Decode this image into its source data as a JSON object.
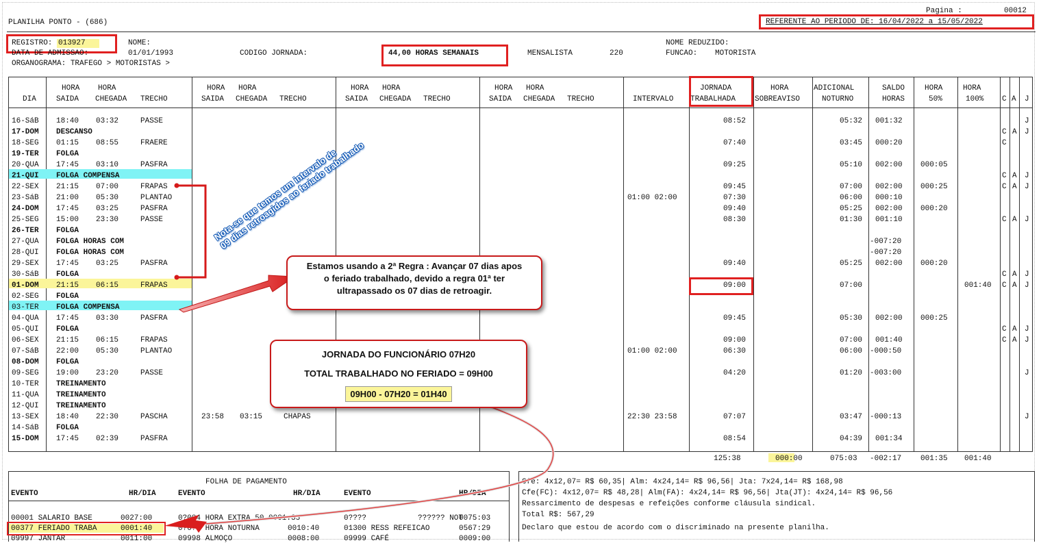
{
  "header": {
    "title": "PLANILHA PONTO - (686)",
    "page_label": "Pagina :",
    "page_number": "00012",
    "period": "REFERENTE AO PERIODO DE: 16/04/2022 a 15/05/2022"
  },
  "employee": {
    "registro_label": "REGISTRO:",
    "registro_value": "013927",
    "nome_label": "NOME:",
    "admissao_label": "DATA DE ADMISSAO:",
    "admissao_value": "01/01/1993",
    "codigo_jornada_label": "CODIGO JORNADA:",
    "jornada_value": "44,00 HORAS SEMANAIS",
    "mensalista": "MENSALISTA",
    "mensalista_hours": "220",
    "nome_reduzido_label": "NOME REDUZIDO:",
    "funcao_label": "FUNCAO:",
    "funcao_value": "MOTORISTA",
    "organograma": "ORGANOGRAMA: TRAFEGO > MOTORISTAS >"
  },
  "table_headers": {
    "dia": "DIA",
    "hora": "HORA",
    "saida": "SAIDA",
    "chegada": "CHEGADA",
    "trecho": "TRECHO",
    "intervalo": "INTERVALO",
    "jornada1": "JORNADA",
    "jornada2": "TRABALHADA",
    "sobreaviso": "SOBREAVISO",
    "adicional1": "ADICIONAL",
    "adicional2": "NOTURNO",
    "saldo1": "SALDO",
    "saldo2": "HORAS",
    "h50": "50%",
    "h100": "100%",
    "c": "C",
    "a": "A",
    "j": "J"
  },
  "rows": [
    {
      "dia": "16-SáB",
      "s1": "18:40",
      "c1": "03:32",
      "t1": "PASSE",
      "s2": "",
      "c2": "",
      "t2": "",
      "interval": "",
      "jornada": "08:52",
      "adic": "05:32",
      "saldo": "001:32",
      "h50": "",
      "h100": "",
      "cc": "",
      "aa": "",
      "jj": "J"
    },
    {
      "dia": "17-DOM",
      "s1": "DESCANSO",
      "c1": "",
      "t1": "",
      "s2": "",
      "c2": "",
      "t2": "",
      "interval": "",
      "jornada": "",
      "adic": "",
      "saldo": "",
      "h50": "",
      "h100": "",
      "cc": "C",
      "aa": "A",
      "jj": "J"
    },
    {
      "dia": "18-SEG",
      "s1": "01:15",
      "c1": "08:55",
      "t1": "FRAERE",
      "s2": "",
      "c2": "",
      "t2": "",
      "interval": "",
      "jornada": "07:40",
      "adic": "03:45",
      "saldo": "000:20",
      "h50": "",
      "h100": "",
      "cc": "C",
      "aa": "",
      "jj": ""
    },
    {
      "dia": "19-TER",
      "s1": "FOLGA",
      "c1": "",
      "t1": "",
      "s2": "",
      "c2": "",
      "t2": "",
      "interval": "",
      "jornada": "",
      "adic": "",
      "saldo": "",
      "h50": "",
      "h100": "",
      "cc": "",
      "aa": "",
      "jj": ""
    },
    {
      "dia": "20-QUA",
      "s1": "17:45",
      "c1": "03:10",
      "t1": "PASFRA",
      "s2": "",
      "c2": "",
      "t2": "",
      "interval": "",
      "jornada": "09:25",
      "adic": "05:10",
      "saldo": "002:00",
      "h50": "000:05",
      "h100": "",
      "cc": "",
      "aa": "",
      "jj": ""
    },
    {
      "dia": "21-QUI",
      "s1": "FOLGA COMPENSA",
      "c1": "",
      "t1": "",
      "s2": "",
      "c2": "",
      "t2": "",
      "interval": "",
      "jornada": "",
      "adic": "",
      "saldo": "",
      "h50": "",
      "h100": "",
      "cc": "C",
      "aa": "A",
      "jj": "J"
    },
    {
      "dia": "22-SEX",
      "s1": "21:15",
      "c1": "07:00",
      "t1": "FRAPAS",
      "s2": "",
      "c2": "",
      "t2": "",
      "interval": "",
      "jornada": "09:45",
      "adic": "07:00",
      "saldo": "002:00",
      "h50": "000:25",
      "h100": "",
      "cc": "C",
      "aa": "A",
      "jj": "J"
    },
    {
      "dia": "23-SáB",
      "s1": "21:00",
      "c1": "05:30",
      "t1": "PLANTAO",
      "s2": "",
      "c2": "",
      "t2": "",
      "interval": "01:00 02:00",
      "jornada": "07:30",
      "adic": "06:00",
      "saldo": "000:10",
      "h50": "",
      "h100": "",
      "cc": "",
      "aa": "",
      "jj": ""
    },
    {
      "dia": "24-DOM",
      "s1": "17:45",
      "c1": "03:25",
      "t1": "PASFRA",
      "s2": "",
      "c2": "",
      "t2": "",
      "interval": "",
      "jornada": "09:40",
      "adic": "05:25",
      "saldo": "002:00",
      "h50": "000:20",
      "h100": "",
      "cc": "",
      "aa": "",
      "jj": ""
    },
    {
      "dia": "25-SEG",
      "s1": "15:00",
      "c1": "23:30",
      "t1": "PASSE",
      "s2": "",
      "c2": "",
      "t2": "",
      "interval": "",
      "jornada": "08:30",
      "adic": "01:30",
      "saldo": "001:10",
      "h50": "",
      "h100": "",
      "cc": "C",
      "aa": "A",
      "jj": "J"
    },
    {
      "dia": "26-TER",
      "s1": "FOLGA",
      "c1": "",
      "t1": "",
      "s2": "",
      "c2": "",
      "t2": "",
      "interval": "",
      "jornada": "",
      "adic": "",
      "saldo": "",
      "h50": "",
      "h100": "",
      "cc": "",
      "aa": "",
      "jj": ""
    },
    {
      "dia": "27-QUA",
      "s1": "FOLGA HORAS COM",
      "c1": "",
      "t1": "",
      "s2": "",
      "c2": "",
      "t2": "",
      "interval": "",
      "jornada": "",
      "adic": "",
      "saldo": "-007:20",
      "h50": "",
      "h100": "",
      "cc": "",
      "aa": "",
      "jj": ""
    },
    {
      "dia": "28-QUI",
      "s1": "FOLGA HORAS COM",
      "c1": "",
      "t1": "",
      "s2": "",
      "c2": "",
      "t2": "",
      "interval": "",
      "jornada": "",
      "adic": "",
      "saldo": "-007:20",
      "h50": "",
      "h100": "",
      "cc": "",
      "aa": "",
      "jj": ""
    },
    {
      "dia": "29-SEX",
      "s1": "17:45",
      "c1": "03:25",
      "t1": "PASFRA",
      "s2": "",
      "c2": "",
      "t2": "",
      "interval": "",
      "jornada": "09:40",
      "adic": "05:25",
      "saldo": "002:00",
      "h50": "000:20",
      "h100": "",
      "cc": "",
      "aa": "",
      "jj": ""
    },
    {
      "dia": "30-SáB",
      "s1": "FOLGA",
      "c1": "",
      "t1": "",
      "s2": "",
      "c2": "",
      "t2": "",
      "interval": "",
      "jornada": "",
      "adic": "",
      "saldo": "",
      "h50": "",
      "h100": "",
      "cc": "C",
      "aa": "A",
      "jj": "J"
    },
    {
      "dia": "01-DOM",
      "s1": "21:15",
      "c1": "06:15",
      "t1": "FRAPAS",
      "s2": "",
      "c2": "",
      "t2": "",
      "interval": "",
      "jornada": "09:00",
      "adic": "07:00",
      "saldo": "",
      "h50": "",
      "h100": "001:40",
      "cc": "C",
      "aa": "A",
      "jj": "J"
    },
    {
      "dia": "02-SEG",
      "s1": "FOLGA",
      "c1": "",
      "t1": "",
      "s2": "",
      "c2": "",
      "t2": "",
      "interval": "",
      "jornada": "",
      "adic": "",
      "saldo": "",
      "h50": "",
      "h100": "",
      "cc": "",
      "aa": "",
      "jj": ""
    },
    {
      "dia": "03-TER",
      "s1": "FOLGA COMPENSA",
      "c1": "",
      "t1": "",
      "s2": "",
      "c2": "",
      "t2": "",
      "interval": "",
      "jornada": "",
      "adic": "",
      "saldo": "",
      "h50": "",
      "h100": "",
      "cc": "",
      "aa": "",
      "jj": ""
    },
    {
      "dia": "04-QUA",
      "s1": "17:45",
      "c1": "03:30",
      "t1": "PASFRA",
      "s2": "",
      "c2": "",
      "t2": "",
      "interval": "",
      "jornada": "09:45",
      "adic": "05:30",
      "saldo": "002:00",
      "h50": "000:25",
      "h100": "",
      "cc": "",
      "aa": "",
      "jj": ""
    },
    {
      "dia": "05-QUI",
      "s1": "FOLGA",
      "c1": "",
      "t1": "",
      "s2": "",
      "c2": "",
      "t2": "",
      "interval": "",
      "jornada": "",
      "adic": "",
      "saldo": "",
      "h50": "",
      "h100": "",
      "cc": "C",
      "aa": "A",
      "jj": "J"
    },
    {
      "dia": "06-SEX",
      "s1": "21:15",
      "c1": "06:15",
      "t1": "FRAPAS",
      "s2": "",
      "c2": "",
      "t2": "",
      "interval": "",
      "jornada": "09:00",
      "adic": "07:00",
      "saldo": "001:40",
      "h50": "",
      "h100": "",
      "cc": "C",
      "aa": "A",
      "jj": "J"
    },
    {
      "dia": "07-SáB",
      "s1": "22:00",
      "c1": "05:30",
      "t1": "PLANTAO",
      "s2": "",
      "c2": "",
      "t2": "",
      "interval": "01:00 02:00",
      "jornada": "06:30",
      "adic": "06:00",
      "saldo": "-000:50",
      "h50": "",
      "h100": "",
      "cc": "",
      "aa": "",
      "jj": ""
    },
    {
      "dia": "08-DOM",
      "s1": "FOLGA",
      "c1": "",
      "t1": "",
      "s2": "",
      "c2": "",
      "t2": "",
      "interval": "",
      "jornada": "",
      "adic": "",
      "saldo": "",
      "h50": "",
      "h100": "",
      "cc": "",
      "aa": "",
      "jj": ""
    },
    {
      "dia": "09-SEG",
      "s1": "19:00",
      "c1": "23:20",
      "t1": "PASSE",
      "s2": "",
      "c2": "",
      "t2": "",
      "interval": "",
      "jornada": "04:20",
      "adic": "01:20",
      "saldo": "-003:00",
      "h50": "",
      "h100": "",
      "cc": "",
      "aa": "",
      "jj": "J"
    },
    {
      "dia": "10-TER",
      "s1": "TREINAMENTO",
      "c1": "",
      "t1": "",
      "s2": "",
      "c2": "",
      "t2": "",
      "interval": "",
      "jornada": "",
      "adic": "",
      "saldo": "",
      "h50": "",
      "h100": "",
      "cc": "",
      "aa": "",
      "jj": ""
    },
    {
      "dia": "11-QUA",
      "s1": "TREINAMENTO",
      "c1": "",
      "t1": "",
      "s2": "",
      "c2": "",
      "t2": "",
      "interval": "",
      "jornada": "",
      "adic": "",
      "saldo": "",
      "h50": "",
      "h100": "",
      "cc": "",
      "aa": "",
      "jj": ""
    },
    {
      "dia": "12-QUI",
      "s1": "TREINAMENTO",
      "c1": "",
      "t1": "",
      "s2": "",
      "c2": "",
      "t2": "",
      "interval": "",
      "jornada": "",
      "adic": "",
      "saldo": "",
      "h50": "",
      "h100": "",
      "cc": "",
      "aa": "",
      "jj": ""
    },
    {
      "dia": "13-SEX",
      "s1": "18:40",
      "c1": "22:30",
      "t1": "PASCHA",
      "s2": "23:58",
      "c2": "03:15",
      "t2": "CHAPAS",
      "interval": "22:30 23:58",
      "jornada": "07:07",
      "adic": "03:47",
      "saldo": "-000:13",
      "h50": "",
      "h100": "",
      "cc": "",
      "aa": "",
      "jj": "J"
    },
    {
      "dia": "14-SáB",
      "s1": "FOLGA",
      "c1": "",
      "t1": "",
      "s2": "",
      "c2": "",
      "t2": "",
      "interval": "",
      "jornada": "",
      "adic": "",
      "saldo": "",
      "h50": "",
      "h100": "",
      "cc": "",
      "aa": "",
      "jj": ""
    },
    {
      "dia": "15-DOM",
      "s1": "17:45",
      "c1": "02:39",
      "t1": "PASFRA",
      "s2": "",
      "c2": "",
      "t2": "",
      "interval": "",
      "jornada": "08:54",
      "adic": "04:39",
      "saldo": "001:34",
      "h50": "",
      "h100": "",
      "cc": "",
      "aa": "",
      "jj": ""
    }
  ],
  "totals": {
    "jornada": "125:38",
    "sobreaviso": "000:00",
    "adicional": "075:03",
    "saldo": "-002:17",
    "h50": "001:35",
    "h100": "001:40"
  },
  "folha": {
    "title": "FOLHA DE PAGAMENTO",
    "evento_label": "EVENTO",
    "hrdia_label": "HR/DIA",
    "r1c1_code": "00001 SALARIO BASE",
    "r1c1_val": "0027:00",
    "r1c2_code": "0?004 HORA EXTRA 50",
    "r1c2_val": "0001:35",
    "r1c3_code": "0????",
    "r1c3_name": "?????? NOT",
    "r1c3_val": "0075:03",
    "r2c1_code": "00377 FERIADO TRABA",
    "r2c1_val": "0001:40",
    "r2c2_code": "0?0?? HORA NOTURNA",
    "r2c2_val": "0010:40",
    "r2c3_code": "01300 RESS REFEICAO",
    "r2c3_val": "0567:29",
    "r3c1_code": "09997 JANTAR",
    "r3c1_val": "0011:00",
    "r3c2_code": "09998 ALMOÇO",
    "r3c2_val": "0008:00",
    "r3c3_code": "09999 CAFÉ",
    "r3c3_val": "0009:00"
  },
  "notes": {
    "line1": "Cfe: 4x12,07= R$ 60,35| Alm: 4x24,14= R$ 96,56| Jta: 7x24,14= R$ 168,98",
    "line2": "Cfe(FC): 4x12,07= R$ 48,28| Alm(FA): 4x24,14= R$ 96,56| Jta(JT): 4x24,14= R$ 96,56",
    "line3": "Ressarcimento de despesas e refeições conforme cláusula sindical.",
    "line4": "Total R$: 567,29",
    "line5": "Declaro que estou de acordo com o discriminado na presente planilha."
  },
  "annotations": {
    "rotated_note": "Nota-se que temos um intervalo de\n09 dias retroagidos ao feriado trabalhado",
    "callout1": "Estamos usando a 2ª Regra : Avançar 07 dias apos o feriado trabalhado, devido a regra 01ª ter ultrapassado os 07 dias de retroagir.",
    "callout2_line1": "JORNADA DO FUNCIONÁRIO 07H20",
    "callout2_line2": "TOTAL TRABALHADO NO FERIADO = 09H00",
    "callout2_line3": "09H00 - 07H20 = 01H40"
  },
  "colors": {
    "red": "#e02020",
    "cyan_highlight": "#7ff3f5",
    "yellow_highlight": "#fbf59a"
  }
}
